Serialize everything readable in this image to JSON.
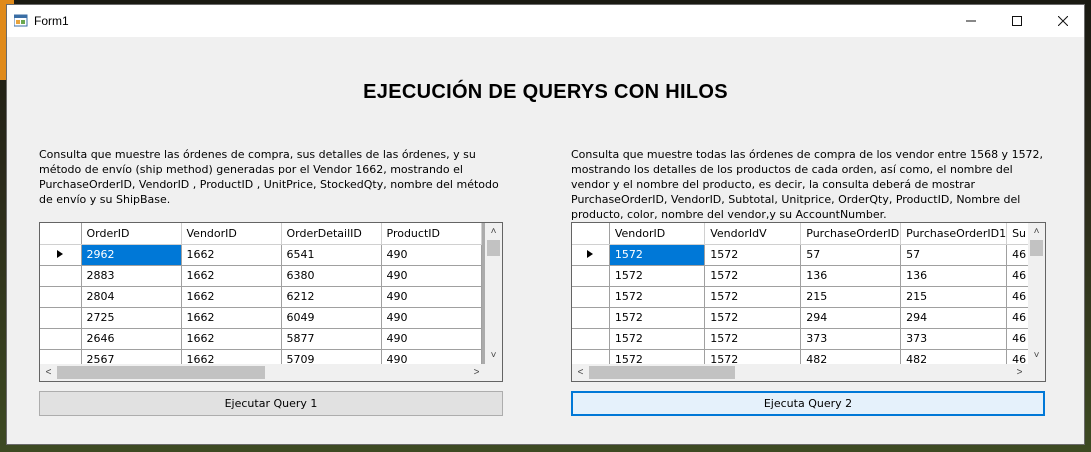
{
  "window": {
    "title": "Form1"
  },
  "main_title": "EJECUCIÓN DE QUERYS CON HILOS",
  "query1": {
    "description": "Consulta que muestre las órdenes de compra, sus detalles de las órdenes, y su método de envío (ship method) generadas por el Vendor 1662, mostrando el PurchaseOrderID, VendorID , ProductID , UnitPrice, StockedQty, nombre del método de envío y su ShipBase.",
    "columns": [
      "OrderID",
      "VendorID",
      "OrderDetailID",
      "ProductID"
    ],
    "rows": [
      [
        "2962",
        "1662",
        "6541",
        "490"
      ],
      [
        "2883",
        "1662",
        "6380",
        "490"
      ],
      [
        "2804",
        "1662",
        "6212",
        "490"
      ],
      [
        "2725",
        "1662",
        "6049",
        "490"
      ],
      [
        "2646",
        "1662",
        "5877",
        "490"
      ],
      [
        "2567",
        "1662",
        "5709",
        "490"
      ]
    ],
    "button_label": "Ejecutar Query 1"
  },
  "query2": {
    "description": "Consulta que muestre todas las órdenes de compra de los vendor entre 1568 y 1572, mostrando los detalles de los productos de cada orden, así como, el nombre del vendor y el nombre del producto, es decir, la consulta deberá de mostrar PurchaseOrderID, VendorID, Subtotal, Unitprice, OrderQty, ProductID, Nombre del producto, color, nombre del vendor,y su AccountNumber.",
    "columns": [
      "VendorID",
      "VendorIdV",
      "PurchaseOrderID",
      "PurchaseOrderID1",
      "Su"
    ],
    "rows": [
      [
        "1572",
        "1572",
        "57",
        "57",
        "46"
      ],
      [
        "1572",
        "1572",
        "136",
        "136",
        "46"
      ],
      [
        "1572",
        "1572",
        "215",
        "215",
        "46"
      ],
      [
        "1572",
        "1572",
        "294",
        "294",
        "46"
      ],
      [
        "1572",
        "1572",
        "373",
        "373",
        "46"
      ],
      [
        "1572",
        "1572",
        "482",
        "482",
        "46"
      ]
    ],
    "button_label": "Ejecuta Query 2"
  },
  "icons": {
    "app": "form-icon",
    "minimize": "minimize-icon",
    "maximize": "maximize-icon",
    "close": "close-icon",
    "row_pointer": "triangle-right-icon"
  },
  "colors": {
    "selection": "#0078d7",
    "window_bg": "#f0f0f0",
    "grid_bg": "#ababab"
  }
}
